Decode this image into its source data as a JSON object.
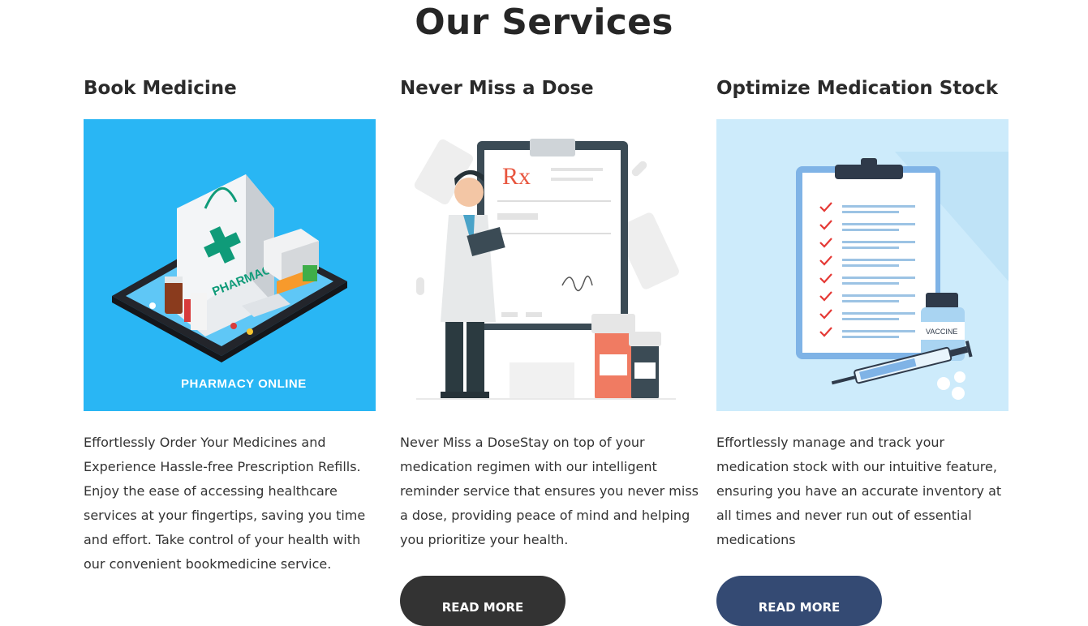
{
  "page": {
    "title": "Our Services"
  },
  "services": [
    {
      "title": "Book Medicine",
      "image_text": "PHARMACY ONLINE",
      "bag_text": "PHARMACY",
      "description": "Effortlessly Order Your Medicines and Experience Hassle-free Prescription Refills. Enjoy the ease of accessing healthcare services at your fingertips, saving you time and effort. Take control of your health with our convenient bookmedicine service."
    },
    {
      "title": "Never Miss a Dose",
      "rx_text": "Rx",
      "description": "Never Miss a DoseStay on top of your medication regimen with our intelligent reminder service that ensures you never miss a dose, providing peace of mind and helping you prioritize your health.",
      "button_label": "READ MORE"
    },
    {
      "title": "Optimize Medication Stock",
      "vial_text": "VACCINE",
      "description": "Effortlessly manage and track your medication stock with our intuitive feature, ensuring you have an accurate inventory at all times and never run out of essential medications",
      "button_label": "READ MORE"
    }
  ],
  "colors": {
    "pharmacy_bg": "#29b6f4",
    "stock_bg": "#cdebfb",
    "dark_button": "#333333",
    "blue_button": "#344a73",
    "pharmacy_green": "#0f9b79",
    "rx_red": "#e8563f"
  }
}
